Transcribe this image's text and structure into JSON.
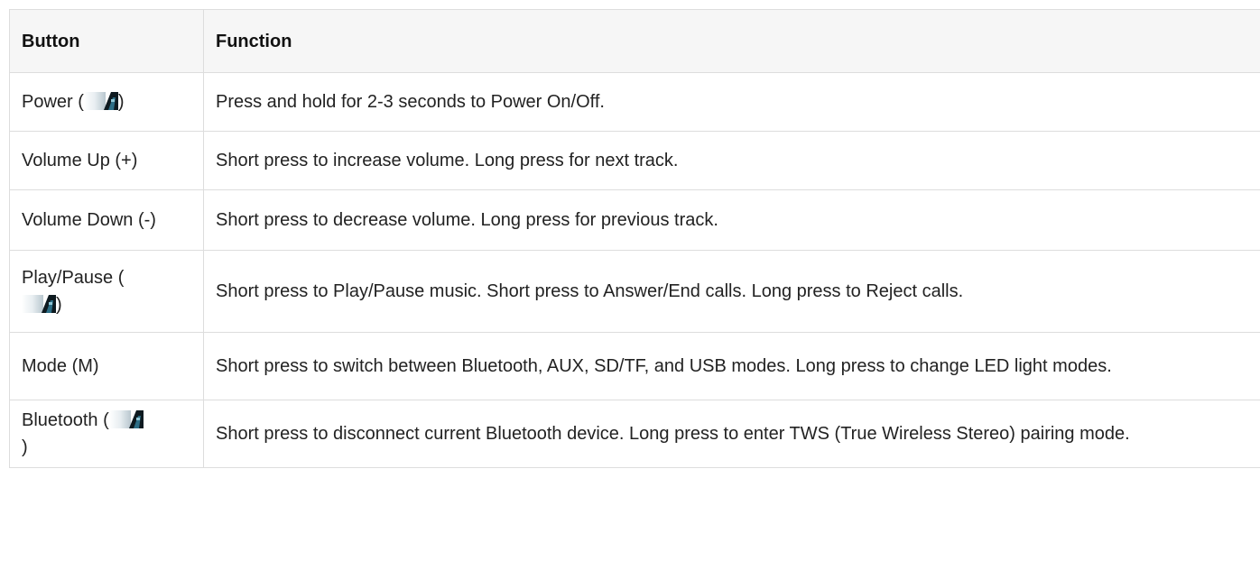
{
  "table": {
    "headers": [
      "Button",
      "Function"
    ],
    "rows": [
      {
        "button": {
          "before": "Power (",
          "icon": "power-icon",
          "after": ")"
        },
        "function": "Press and hold for 2-3 seconds to Power On/Off."
      },
      {
        "button": {
          "before": "Volume Up (+)",
          "icon": null,
          "after": ""
        },
        "function": "Short press to increase volume. Long press for next track."
      },
      {
        "button": {
          "before": "Volume Down (-)",
          "icon": null,
          "after": ""
        },
        "function": "Short press to decrease volume. Long press for previous track."
      },
      {
        "button": {
          "before": "Play/Pause (",
          "icon": "play-pause-icon",
          "after": ")"
        },
        "function": "Short press to Play/Pause music. Short press to Answer/End calls. Long press to Reject calls."
      },
      {
        "button": {
          "before": "Mode (M)",
          "icon": null,
          "after": ""
        },
        "function": "Short press to switch between Bluetooth, AUX, SD/TF, and USB modes. Long press to change LED light modes."
      },
      {
        "button": {
          "before": "Bluetooth (",
          "icon": "bluetooth-icon",
          "after": ")"
        },
        "function": "Short press to disconnect current Bluetooth device. Long press to enter TWS (True Wireless Stereo) pairing mode."
      }
    ]
  }
}
